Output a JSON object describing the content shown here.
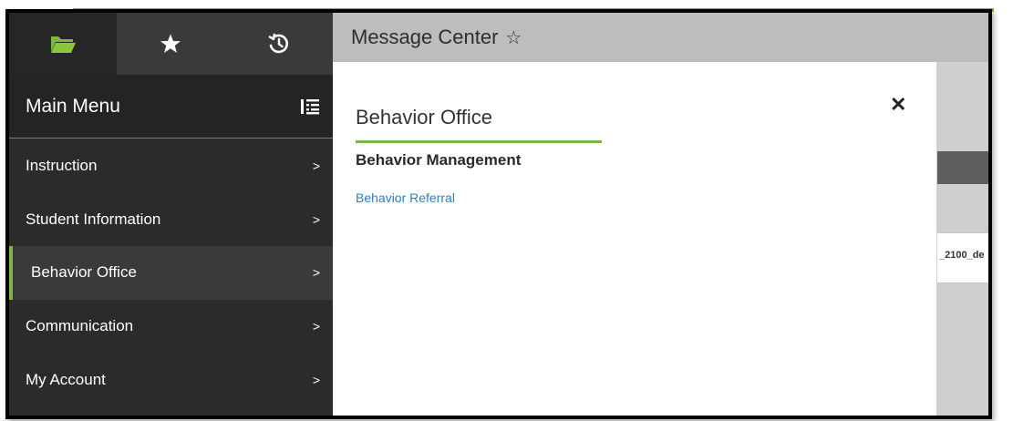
{
  "header": {
    "title": "Message Center",
    "favorite_icon": "star-outline-icon"
  },
  "tabs": [
    {
      "icon": "folder-open-icon",
      "active": true
    },
    {
      "icon": "star-icon",
      "active": false
    },
    {
      "icon": "history-icon",
      "active": false
    }
  ],
  "sidebar": {
    "title": "Main Menu",
    "toggle_icon": "list-toggle-icon",
    "items": [
      {
        "label": "Instruction",
        "active": false
      },
      {
        "label": "Student Information",
        "active": false
      },
      {
        "label": "Behavior Office",
        "active": true
      },
      {
        "label": "Communication",
        "active": false
      },
      {
        "label": "My Account",
        "active": false
      }
    ]
  },
  "panel": {
    "title": "Behavior Office",
    "close_label": "✕",
    "section_title": "Behavior Management",
    "links": [
      "Behavior Referral"
    ]
  },
  "background": {
    "cell_text": "_2100_de"
  },
  "colors": {
    "accent": "#7ab648",
    "sidebar_bg": "#2b2b2b",
    "link": "#2a7fc1"
  }
}
